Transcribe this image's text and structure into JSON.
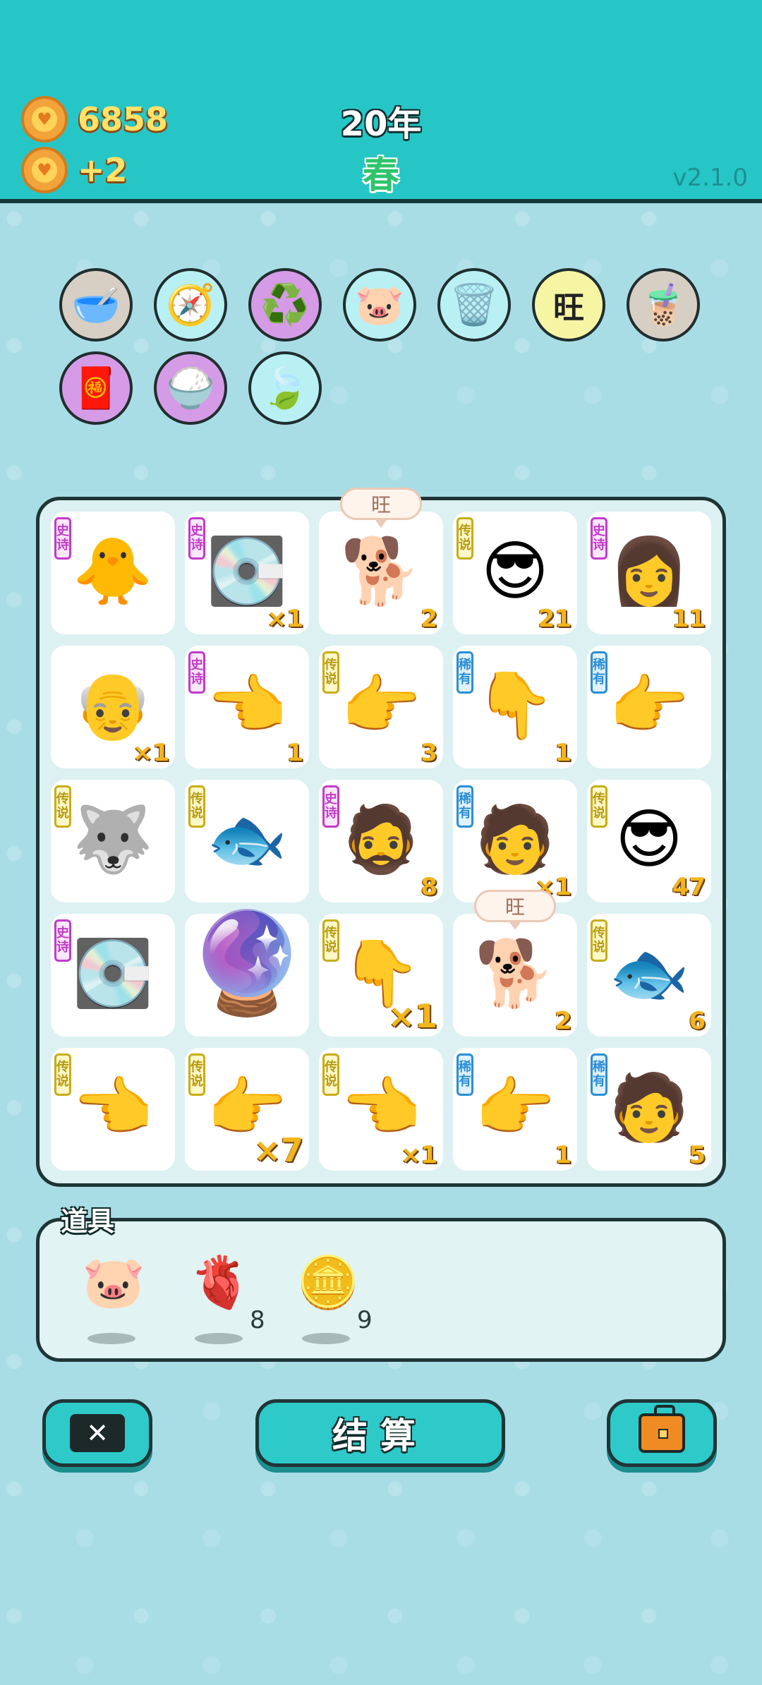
{
  "header": {
    "coins": "6858",
    "coins_income": "+2",
    "year": "20年",
    "season": "春",
    "version": "v2.1.0"
  },
  "buffs": [
    {
      "name": "dog-bowl-icon",
      "glyph": "🥣",
      "bg": "#d7cfc3"
    },
    {
      "name": "compass-icon",
      "glyph": "🧭",
      "bg": "#b9f0f3"
    },
    {
      "name": "recycle-icon",
      "glyph": "♻️",
      "bg": "#d59be6"
    },
    {
      "name": "piggy-bank-icon",
      "glyph": "🐷",
      "bg": "#b9f0f3"
    },
    {
      "name": "garbage-bag-icon",
      "glyph": "🗑️",
      "bg": "#b9f0f3"
    },
    {
      "name": "wang-text-icon",
      "glyph": "旺",
      "bg": "#f6f5a4"
    },
    {
      "name": "bubble-tea-icon",
      "glyph": "🧋",
      "bg": "#d7cfc3"
    },
    {
      "name": "red-envelope-icon",
      "glyph": "🧧",
      "bg": "#d59be6"
    },
    {
      "name": "rice-bowl-icon",
      "glyph": "🍚",
      "bg": "#d59be6"
    },
    {
      "name": "leaf-icon",
      "glyph": "🍃",
      "bg": "#b9f0f3"
    }
  ],
  "board": [
    {
      "name": "chick-head",
      "glyph": "🐥",
      "tag": "史诗",
      "tier": "epic",
      "count": ""
    },
    {
      "name": "graphics-card",
      "glyph": "💽",
      "tag": "史诗",
      "tier": "epic",
      "count": "×1"
    },
    {
      "name": "husky-dog",
      "glyph": "🐕",
      "tag": "",
      "tier": "",
      "count": "2",
      "bubble": "旺"
    },
    {
      "name": "sunglasses-man",
      "glyph": "😎",
      "tag": "传说",
      "tier": "legend",
      "count": "21"
    },
    {
      "name": "braided-girl",
      "glyph": "👩",
      "tag": "史诗",
      "tier": "epic",
      "count": "11"
    },
    {
      "name": "old-man-glasses",
      "glyph": "👴",
      "tag": "",
      "tier": "",
      "count": "×1"
    },
    {
      "name": "gray-hand-left",
      "glyph": "👈",
      "tag": "史诗",
      "tier": "epic",
      "count": "1"
    },
    {
      "name": "yellow-hand-point",
      "glyph": "👉",
      "tag": "传说",
      "tier": "legend",
      "count": "3"
    },
    {
      "name": "brown-hand-down",
      "glyph": "👇",
      "tag": "稀有",
      "tier": "rare",
      "count": "1"
    },
    {
      "name": "brown-hand-point",
      "glyph": "👉",
      "tag": "稀有",
      "tier": "rare",
      "count": ""
    },
    {
      "name": "king-husky",
      "glyph": "🐺",
      "tag": "传说",
      "tier": "legend",
      "count": ""
    },
    {
      "name": "koi-fish",
      "glyph": "🐟",
      "tag": "传说",
      "tier": "legend",
      "count": ""
    },
    {
      "name": "green-hat-man",
      "glyph": "🧔",
      "tag": "史诗",
      "tier": "epic",
      "count": "8"
    },
    {
      "name": "bucket-hat-man",
      "glyph": "🧑",
      "tag": "稀有",
      "tier": "rare",
      "count": "×1"
    },
    {
      "name": "sunglasses-man-2",
      "glyph": "😎",
      "tag": "传说",
      "tier": "legend",
      "count": "47"
    },
    {
      "name": "graphics-card-2",
      "glyph": "💽",
      "tag": "史诗",
      "tier": "epic",
      "count": ""
    },
    {
      "name": "gacha-capsule",
      "glyph": "🔮",
      "tag": "",
      "tier": "",
      "count": ""
    },
    {
      "name": "yellow-hand-down",
      "glyph": "👇",
      "tag": "传说",
      "tier": "legend",
      "count": "×1",
      "big": true
    },
    {
      "name": "husky-dog-2",
      "glyph": "🐕",
      "tag": "",
      "tier": "",
      "count": "2",
      "bubble": "旺"
    },
    {
      "name": "koi-fish-2",
      "glyph": "🐟",
      "tag": "传说",
      "tier": "legend",
      "count": "6"
    },
    {
      "name": "yellow-hand-left",
      "glyph": "👈",
      "tag": "传说",
      "tier": "legend",
      "count": ""
    },
    {
      "name": "yellow-hand-right",
      "glyph": "👉",
      "tag": "传说",
      "tier": "legend",
      "count": "×7",
      "big": true
    },
    {
      "name": "yellow-hand-left-2",
      "glyph": "👈",
      "tag": "传说",
      "tier": "legend",
      "count": "×1"
    },
    {
      "name": "brown-hand-diag",
      "glyph": "👉",
      "tag": "稀有",
      "tier": "rare",
      "count": "1"
    },
    {
      "name": "bucket-hat-man-2",
      "glyph": "🧑",
      "tag": "稀有",
      "tier": "rare",
      "count": "5"
    }
  ],
  "items": {
    "title": "道具",
    "list": [
      {
        "name": "piggy-bank-item",
        "glyph": "🐷",
        "qty": ""
      },
      {
        "name": "liver-item",
        "glyph": "🫀",
        "qty": "8"
      },
      {
        "name": "dollar-coin-item",
        "glyph": "🪙",
        "qty": "9"
      }
    ]
  },
  "buttons": {
    "settle": "结算"
  }
}
